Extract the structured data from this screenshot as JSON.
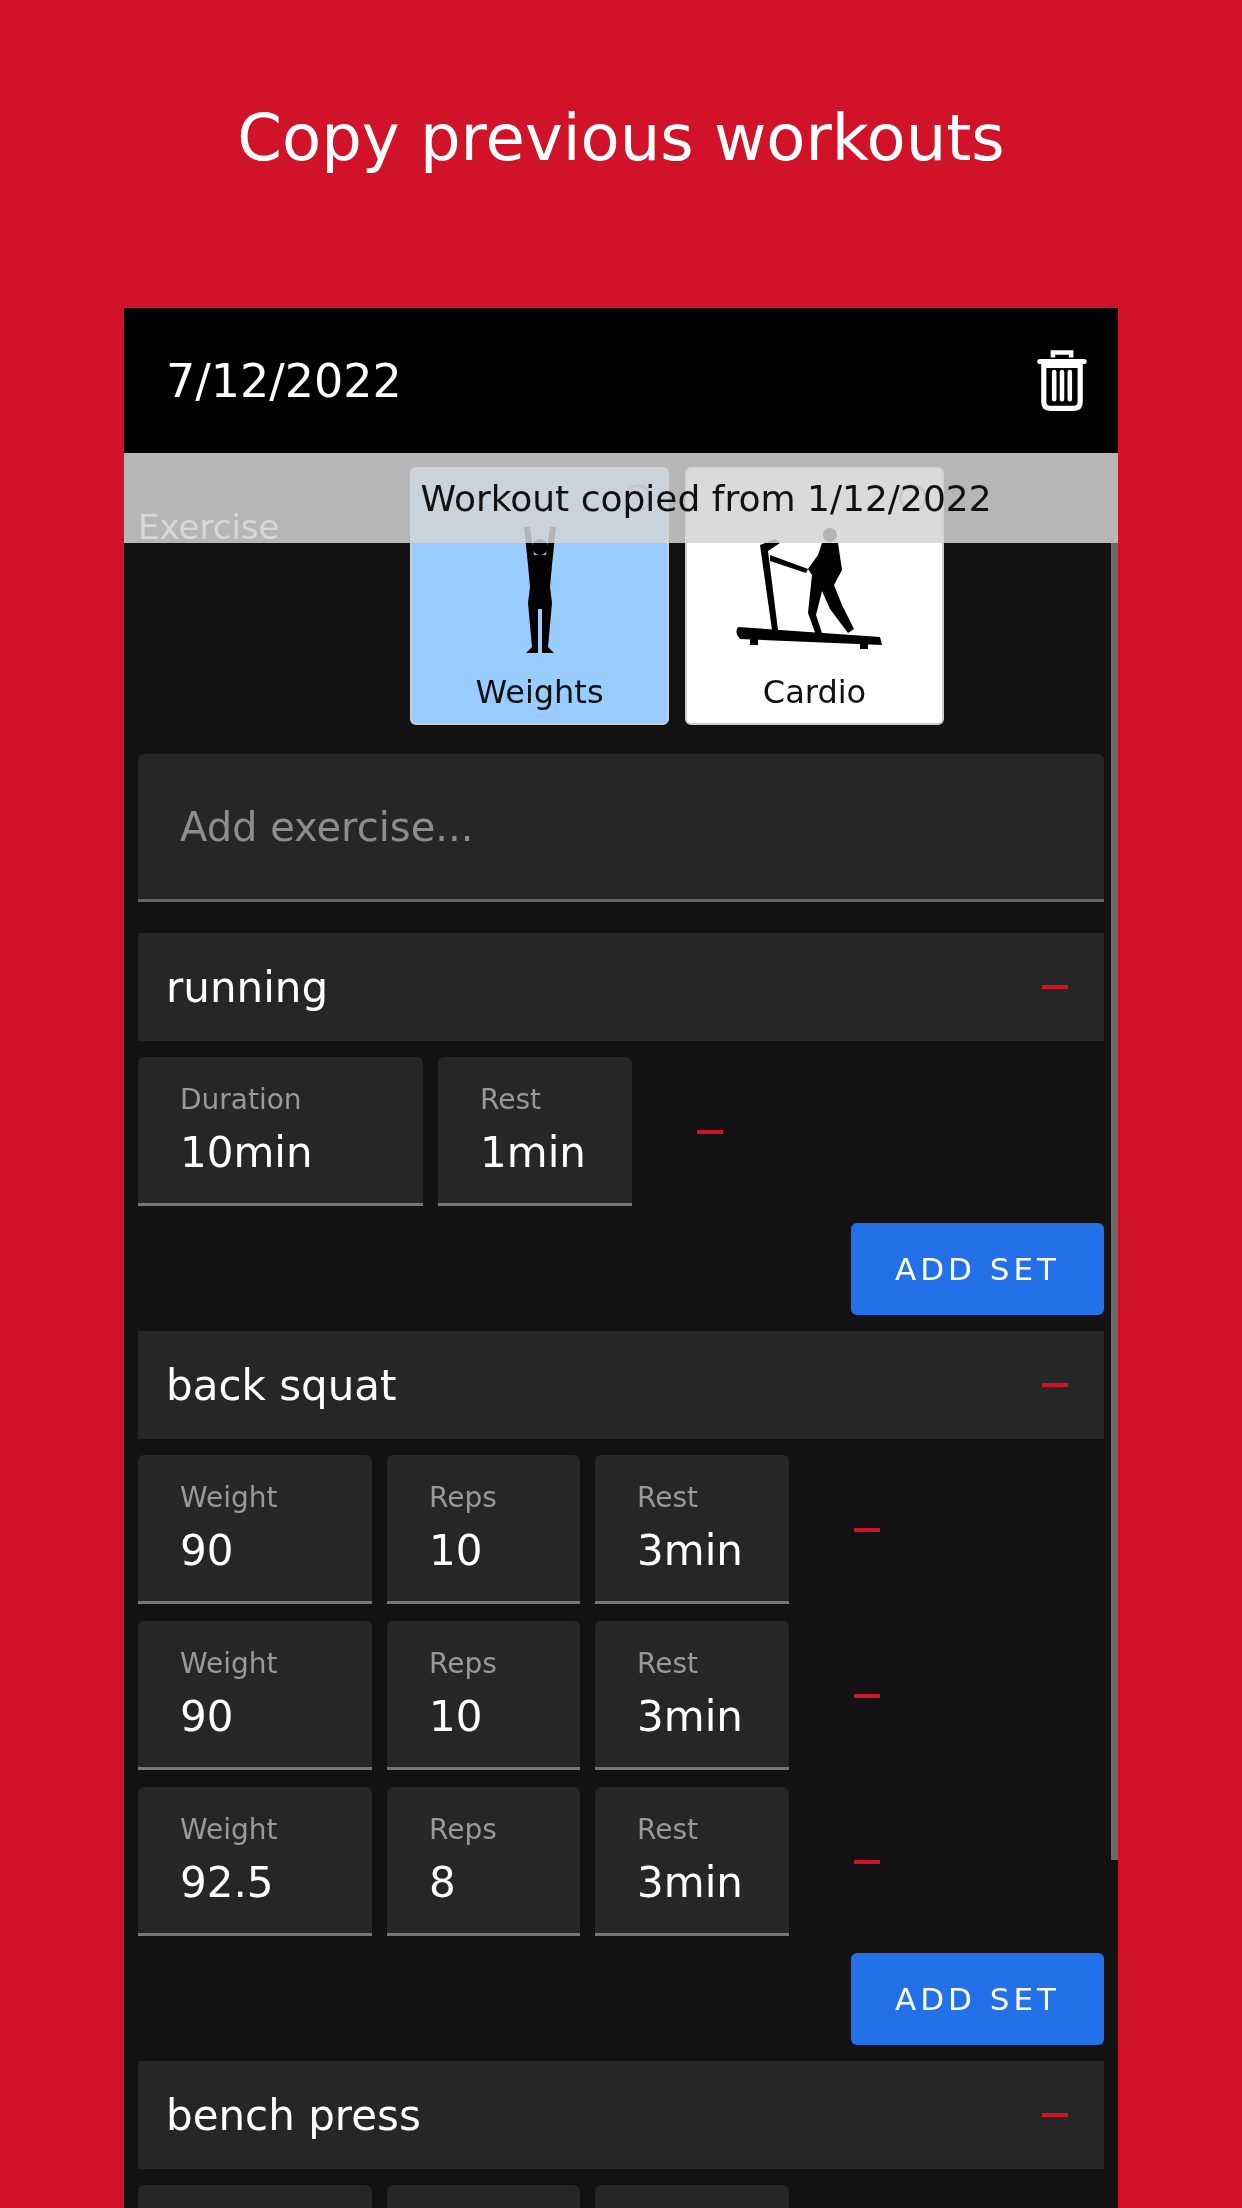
{
  "title": "Copy previous workouts",
  "workout": {
    "date": "7/12/2022"
  },
  "toast": "Workout copied from 1/12/2022",
  "exercise_type": {
    "label": "Exercise",
    "options": [
      {
        "label": "Weights",
        "kind": "weights",
        "selected": true
      },
      {
        "label": "Cardio",
        "kind": "cardio",
        "selected": false
      }
    ]
  },
  "add_exercise": {
    "placeholder": "Add exercise..."
  },
  "exercises": [
    {
      "name": "running",
      "add_set": "ADD SET",
      "sets": [
        {
          "fields": [
            {
              "label": "Duration",
              "value": "10min"
            },
            {
              "label": "Rest",
              "value": "1min"
            }
          ]
        }
      ]
    },
    {
      "name": "back squat",
      "add_set": "ADD SET",
      "sets": [
        {
          "fields": [
            {
              "label": "Weight",
              "value": "90"
            },
            {
              "label": "Reps",
              "value": "10"
            },
            {
              "label": "Rest",
              "value": "3min"
            }
          ]
        },
        {
          "fields": [
            {
              "label": "Weight",
              "value": "90"
            },
            {
              "label": "Reps",
              "value": "10"
            },
            {
              "label": "Rest",
              "value": "3min"
            }
          ]
        },
        {
          "fields": [
            {
              "label": "Weight",
              "value": "92.5"
            },
            {
              "label": "Reps",
              "value": "8"
            },
            {
              "label": "Rest",
              "value": "3min"
            }
          ]
        }
      ]
    },
    {
      "name": "bench press",
      "more_below": true
    }
  ]
}
